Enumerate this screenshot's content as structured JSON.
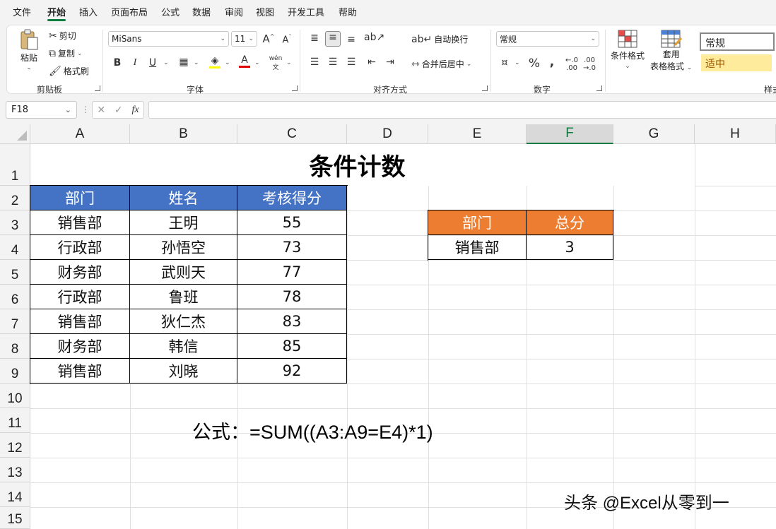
{
  "menu": [
    "文件",
    "开始",
    "插入",
    "页面布局",
    "公式",
    "数据",
    "审阅",
    "视图",
    "开发工具",
    "帮助"
  ],
  "ribbon": {
    "clipboard": {
      "paste": "粘贴",
      "cut": "剪切",
      "copy": "复制",
      "format_painter": "格式刷",
      "label": "剪贴板"
    },
    "font": {
      "name": "MiSans",
      "size": "11",
      "bold": "B",
      "italic": "I",
      "underline": "U",
      "label": "字体",
      "grow": "A",
      "shrink": "A",
      "phonetic": "wén"
    },
    "alignment": {
      "wrap": "自动换行",
      "merge": "合并后居中",
      "label": "对齐方式"
    },
    "number": {
      "format": "常规",
      "label": "数字",
      "percent": "%"
    },
    "styles": {
      "conditional": "条件格式",
      "table_format_1": "套用",
      "table_format_2": "表格格式",
      "style_normal": "常规",
      "style_neutral": "适中",
      "label": "样式"
    }
  },
  "namebox": "F18",
  "fx": "fx",
  "columns": [
    "A",
    "B",
    "C",
    "D",
    "E",
    "F",
    "G",
    "H"
  ],
  "rows": [
    "1",
    "2",
    "3",
    "4",
    "5",
    "6",
    "7",
    "8",
    "9",
    "10",
    "11",
    "12",
    "13",
    "14",
    "15"
  ],
  "sheet": {
    "title": "条件计数",
    "table_headers": [
      "部门",
      "姓名",
      "考核得分"
    ],
    "table_rows": [
      [
        "销售部",
        "王明",
        "55"
      ],
      [
        "行政部",
        "孙悟空",
        "73"
      ],
      [
        "财务部",
        "武则天",
        "77"
      ],
      [
        "行政部",
        "鲁班",
        "78"
      ],
      [
        "销售部",
        "狄仁杰",
        "83"
      ],
      [
        "财务部",
        "韩信",
        "85"
      ],
      [
        "销售部",
        "刘晓",
        "92"
      ]
    ],
    "summary_headers": [
      "部门",
      "总分"
    ],
    "summary_row": [
      "销售部",
      "3"
    ],
    "formula_label": "公式：",
    "formula": "=SUM((A3:A9=E4)*1)"
  },
  "watermark": "头条 @Excel从零到一",
  "colors": {
    "header_blue": "#4472c4",
    "header_orange": "#ed7d31",
    "accent_green": "#107c41"
  }
}
